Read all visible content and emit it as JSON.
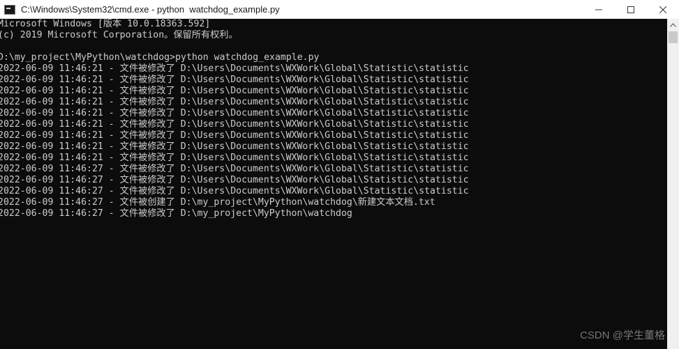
{
  "window": {
    "title": "C:\\Windows\\System32\\cmd.exe - python  watchdog_example.py",
    "controls": {
      "minimize_icon": "minimize-icon",
      "maximize_icon": "maximize-icon",
      "close_icon": "close-icon"
    }
  },
  "console": {
    "lines": [
      "Microsoft Windows [版本 10.0.18363.592]",
      "(c) 2019 Microsoft Corporation。保留所有权利。",
      "",
      "D:\\my_project\\MyPython\\watchdog>python watchdog_example.py",
      "2022-06-09 11:46:21 - 文件被修改了 D:\\Users\\Documents\\WXWork\\Global\\Statistic\\statistic",
      "2022-06-09 11:46:21 - 文件被修改了 D:\\Users\\Documents\\WXWork\\Global\\Statistic\\statistic",
      "2022-06-09 11:46:21 - 文件被修改了 D:\\Users\\Documents\\WXWork\\Global\\Statistic\\statistic",
      "2022-06-09 11:46:21 - 文件被修改了 D:\\Users\\Documents\\WXWork\\Global\\Statistic\\statistic",
      "2022-06-09 11:46:21 - 文件被修改了 D:\\Users\\Documents\\WXWork\\Global\\Statistic\\statistic",
      "2022-06-09 11:46:21 - 文件被修改了 D:\\Users\\Documents\\WXWork\\Global\\Statistic\\statistic",
      "2022-06-09 11:46:21 - 文件被修改了 D:\\Users\\Documents\\WXWork\\Global\\Statistic\\statistic",
      "2022-06-09 11:46:21 - 文件被修改了 D:\\Users\\Documents\\WXWork\\Global\\Statistic\\statistic",
      "2022-06-09 11:46:21 - 文件被修改了 D:\\Users\\Documents\\WXWork\\Global\\Statistic\\statistic",
      "2022-06-09 11:46:27 - 文件被修改了 D:\\Users\\Documents\\WXWork\\Global\\Statistic\\statistic",
      "2022-06-09 11:46:27 - 文件被修改了 D:\\Users\\Documents\\WXWork\\Global\\Statistic\\statistic",
      "2022-06-09 11:46:27 - 文件被修改了 D:\\Users\\Documents\\WXWork\\Global\\Statistic\\statistic",
      "2022-06-09 11:46:27 - 文件被创建了 D:\\my_project\\MyPython\\watchdog\\新建文本文档.txt",
      "2022-06-09 11:46:27 - 文件被修改了 D:\\my_project\\MyPython\\watchdog"
    ]
  },
  "watermark": "CSDN @学生董格",
  "colors": {
    "console_bg": "#0c0c0c",
    "console_text": "#cccccc",
    "titlebar_bg": "#ffffff"
  }
}
